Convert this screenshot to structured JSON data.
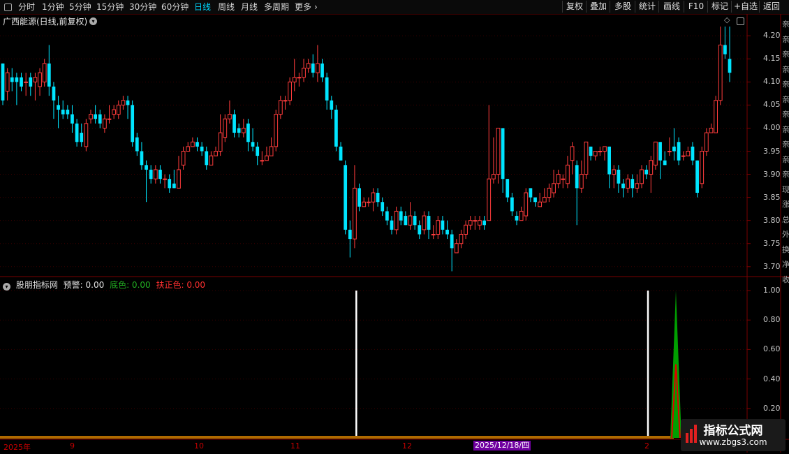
{
  "toolbar": {
    "timeframes": [
      "分时",
      "1分钟",
      "5分钟",
      "15分钟",
      "30分钟",
      "60分钟",
      "日线",
      "周线",
      "月线",
      "多周期",
      "更多"
    ],
    "active_timeframe": "日线",
    "right_buttons": [
      "复权",
      "叠加",
      "多股",
      "统计",
      "画线",
      "F10",
      "标记",
      "+自选",
      "返回"
    ]
  },
  "main_panel": {
    "title": "广西能源(日线,前复权)",
    "y_ticks": [
      "4.20",
      "4.15",
      "4.10",
      "4.05",
      "4.00",
      "3.95",
      "3.90",
      "3.85",
      "3.80",
      "3.75",
      "3.70"
    ]
  },
  "indicator_panel": {
    "name": "股朋指标网",
    "warning_label": "预警: 0.00",
    "bottom_label": "底色: 0.00",
    "support_label": "扶正色: 0.00",
    "y_ticks": [
      "1.00",
      "0.80",
      "0.60",
      "0.40",
      "0.20"
    ]
  },
  "date_axis": {
    "labels": [
      "2025年",
      "9",
      "10",
      "11",
      "12",
      "2"
    ],
    "highlight": "2025/12/18/四"
  },
  "right_panel_chars": [
    "亲",
    "亲",
    "亲",
    "亲",
    "亲",
    "亲",
    "亲",
    "亲",
    "亲",
    "亲",
    "亲",
    "现",
    "涨",
    "总",
    "外",
    "换",
    "净",
    "收"
  ],
  "watermark": {
    "title": "指标公式网",
    "url": "www.zbgs3.com"
  },
  "colors": {
    "up": "#ff3c3c",
    "down": "#00e5ff",
    "frame": "#7a0000",
    "indicator_green": "#00a000",
    "indicator_red": "#e00000",
    "baseline": "#b06a00"
  },
  "chart_data": {
    "type": "candlestick",
    "y_range": [
      3.68,
      4.22
    ],
    "candles": [
      [
        4.14,
        4.06,
        4.14,
        4.05
      ],
      [
        4.08,
        4.12,
        4.13,
        4.06
      ],
      [
        4.11,
        4.1,
        4.13,
        4.08
      ],
      [
        4.11,
        4.1,
        4.12,
        4.05
      ],
      [
        4.11,
        4.09,
        4.12,
        4.08
      ],
      [
        4.1,
        4.1,
        4.12,
        4.07
      ],
      [
        4.11,
        4.09,
        4.12,
        4.07
      ],
      [
        4.1,
        4.11,
        4.12,
        4.06
      ],
      [
        4.09,
        4.12,
        4.13,
        4.07
      ],
      [
        4.1,
        4.14,
        4.15,
        4.09
      ],
      [
        4.14,
        4.09,
        4.18,
        4.07
      ],
      [
        4.09,
        4.06,
        4.1,
        4.02
      ],
      [
        4.05,
        4.04,
        4.07,
        4.0
      ],
      [
        4.04,
        4.03,
        4.06,
        4.02
      ],
      [
        4.04,
        4.03,
        4.05,
        4.02
      ],
      [
        4.03,
        4.01,
        4.05,
        3.99
      ],
      [
        4.01,
        3.97,
        4.02,
        3.96
      ],
      [
        3.99,
        3.97,
        4.01,
        3.96
      ],
      [
        3.96,
        4.01,
        4.02,
        3.95
      ],
      [
        4.02,
        4.03,
        4.04,
        4.01
      ],
      [
        4.03,
        4.02,
        4.05,
        4.01
      ],
      [
        4.03,
        4.01,
        4.04,
        4.0
      ],
      [
        4.0,
        4.02,
        4.03,
        3.99
      ],
      [
        4.02,
        4.02,
        4.05,
        4.01
      ],
      [
        4.03,
        4.04,
        4.05,
        4.02
      ],
      [
        4.03,
        4.05,
        4.06,
        4.02
      ],
      [
        4.05,
        4.06,
        4.07,
        4.04
      ],
      [
        4.06,
        4.05,
        4.07,
        4.02
      ],
      [
        4.05,
        3.97,
        4.06,
        3.96
      ],
      [
        3.98,
        3.95,
        3.99,
        3.94
      ],
      [
        3.95,
        3.92,
        3.97,
        3.91
      ],
      [
        3.92,
        3.91,
        3.93,
        3.84
      ],
      [
        3.91,
        3.89,
        3.92,
        3.88
      ],
      [
        3.89,
        3.91,
        3.92,
        3.88
      ],
      [
        3.91,
        3.89,
        3.92,
        3.88
      ],
      [
        3.89,
        3.89,
        3.9,
        3.87
      ],
      [
        3.89,
        3.87,
        3.9,
        3.86
      ],
      [
        3.88,
        3.87,
        3.91,
        3.87
      ],
      [
        3.87,
        3.91,
        3.94,
        3.87
      ],
      [
        3.92,
        3.95,
        3.96,
        3.91
      ],
      [
        3.95,
        3.96,
        3.97,
        3.95
      ],
      [
        3.96,
        3.97,
        3.98,
        3.96
      ],
      [
        3.97,
        3.96,
        3.98,
        3.95
      ],
      [
        3.96,
        3.95,
        3.97,
        3.94
      ],
      [
        3.95,
        3.92,
        3.96,
        3.91
      ],
      [
        3.92,
        3.94,
        3.95,
        3.92
      ],
      [
        3.94,
        3.95,
        3.96,
        3.94
      ],
      [
        3.95,
        3.99,
        4.03,
        3.94
      ],
      [
        3.98,
        4.02,
        4.03,
        3.97
      ],
      [
        4.02,
        4.03,
        4.06,
        4.01
      ],
      [
        4.03,
        3.99,
        4.04,
        3.98
      ],
      [
        4.0,
        3.99,
        4.01,
        3.98
      ],
      [
        3.99,
        4.0,
        4.02,
        3.98
      ],
      [
        4.01,
        3.97,
        4.02,
        3.95
      ],
      [
        3.97,
        3.96,
        4.0,
        3.95
      ],
      [
        3.96,
        3.94,
        3.97,
        3.92
      ],
      [
        3.93,
        3.93,
        3.95,
        3.92
      ],
      [
        3.93,
        3.94,
        3.96,
        3.93
      ],
      [
        3.94,
        3.96,
        3.98,
        3.94
      ],
      [
        3.96,
        4.03,
        4.04,
        3.95
      ],
      [
        4.03,
        4.06,
        4.07,
        4.02
      ],
      [
        4.06,
        4.06,
        4.07,
        4.04
      ],
      [
        4.06,
        4.1,
        4.11,
        4.05
      ],
      [
        4.1,
        4.11,
        4.15,
        4.08
      ],
      [
        4.11,
        4.11,
        4.12,
        4.09
      ],
      [
        4.11,
        4.13,
        4.15,
        4.1
      ],
      [
        4.13,
        4.14,
        4.15,
        4.12
      ],
      [
        4.14,
        4.12,
        4.16,
        4.11
      ],
      [
        4.12,
        4.14,
        4.18,
        4.1
      ],
      [
        4.14,
        4.11,
        4.15,
        4.1
      ],
      [
        4.11,
        4.06,
        4.12,
        4.04
      ],
      [
        4.06,
        4.04,
        4.07,
        4.02
      ],
      [
        4.04,
        3.96,
        4.05,
        3.95
      ],
      [
        3.96,
        3.93,
        3.97,
        3.93
      ],
      [
        3.92,
        3.78,
        3.93,
        3.77
      ],
      [
        3.78,
        3.76,
        3.8,
        3.72
      ],
      [
        3.76,
        3.87,
        3.92,
        3.74
      ],
      [
        3.87,
        3.83,
        3.88,
        3.82
      ],
      [
        3.83,
        3.84,
        3.85,
        3.83
      ],
      [
        3.84,
        3.84,
        3.85,
        3.83
      ],
      [
        3.84,
        3.86,
        3.87,
        3.82
      ],
      [
        3.86,
        3.84,
        3.87,
        3.83
      ],
      [
        3.84,
        3.82,
        3.85,
        3.81
      ],
      [
        3.82,
        3.8,
        3.83,
        3.79
      ],
      [
        3.8,
        3.78,
        3.81,
        3.77
      ],
      [
        3.78,
        3.82,
        3.83,
        3.77
      ],
      [
        3.82,
        3.8,
        3.83,
        3.79
      ],
      [
        3.81,
        3.79,
        3.82,
        3.79
      ],
      [
        3.79,
        3.81,
        3.84,
        3.78
      ],
      [
        3.81,
        3.79,
        3.82,
        3.78
      ],
      [
        3.79,
        3.77,
        3.8,
        3.76
      ],
      [
        3.78,
        3.81,
        3.82,
        3.77
      ],
      [
        3.81,
        3.78,
        3.82,
        3.76
      ],
      [
        3.77,
        3.77,
        3.79,
        3.76
      ],
      [
        3.77,
        3.8,
        3.81,
        3.76
      ],
      [
        3.8,
        3.78,
        3.81,
        3.77
      ],
      [
        3.78,
        3.77,
        3.8,
        3.76
      ],
      [
        3.77,
        3.74,
        3.78,
        3.69
      ],
      [
        3.73,
        3.75,
        3.76,
        3.74
      ],
      [
        3.75,
        3.77,
        3.78,
        3.74
      ],
      [
        3.77,
        3.79,
        3.8,
        3.76
      ],
      [
        3.79,
        3.8,
        3.81,
        3.78
      ],
      [
        3.8,
        3.8,
        3.81,
        3.78
      ],
      [
        3.79,
        3.8,
        3.81,
        3.78
      ],
      [
        3.8,
        3.79,
        3.81,
        3.78
      ],
      [
        3.8,
        3.89,
        4.05,
        3.8
      ],
      [
        3.89,
        3.9,
        3.98,
        3.88
      ],
      [
        3.9,
        4.0,
        4.0,
        3.88
      ],
      [
        4.0,
        3.89,
        4.0,
        3.86
      ],
      [
        3.89,
        3.85,
        3.89,
        3.84
      ],
      [
        3.85,
        3.82,
        3.86,
        3.81
      ],
      [
        3.81,
        3.8,
        3.82,
        3.79
      ],
      [
        3.8,
        3.82,
        3.83,
        3.8
      ],
      [
        3.81,
        3.86,
        3.87,
        3.8
      ],
      [
        3.87,
        3.85,
        3.87,
        3.84
      ],
      [
        3.85,
        3.84,
        3.85,
        3.83
      ],
      [
        3.83,
        3.84,
        3.86,
        3.83
      ],
      [
        3.84,
        3.85,
        3.87,
        3.84
      ],
      [
        3.85,
        3.87,
        3.88,
        3.84
      ],
      [
        3.86,
        3.88,
        3.91,
        3.85
      ],
      [
        3.88,
        3.9,
        3.91,
        3.87
      ],
      [
        3.89,
        3.89,
        3.9,
        3.87
      ],
      [
        3.88,
        3.92,
        3.94,
        3.87
      ],
      [
        3.93,
        3.96,
        3.97,
        3.9
      ],
      [
        3.92,
        3.87,
        3.93,
        3.79
      ],
      [
        3.87,
        3.9,
        3.93,
        3.86
      ],
      [
        3.9,
        3.97,
        3.97,
        3.89
      ],
      [
        3.96,
        3.94,
        3.96,
        3.93
      ],
      [
        3.94,
        3.95,
        3.95,
        3.93
      ],
      [
        3.95,
        3.95,
        3.96,
        3.94
      ],
      [
        3.95,
        3.96,
        3.96,
        3.93
      ],
      [
        3.96,
        3.9,
        3.96,
        3.87
      ],
      [
        3.9,
        3.91,
        3.92,
        3.87
      ],
      [
        3.91,
        3.88,
        3.92,
        3.86
      ],
      [
        3.88,
        3.87,
        3.89,
        3.85
      ],
      [
        3.87,
        3.89,
        3.9,
        3.86
      ],
      [
        3.89,
        3.87,
        3.9,
        3.85
      ],
      [
        3.87,
        3.88,
        3.9,
        3.86
      ],
      [
        3.88,
        3.91,
        3.92,
        3.87
      ],
      [
        3.91,
        3.9,
        3.92,
        3.89
      ],
      [
        3.9,
        3.93,
        3.94,
        3.86
      ],
      [
        3.92,
        3.97,
        3.97,
        3.91
      ],
      [
        3.97,
        3.93,
        3.97,
        3.89
      ],
      [
        3.93,
        3.92,
        3.95,
        3.92
      ],
      [
        3.95,
        3.95,
        3.98,
        3.94
      ],
      [
        3.96,
        3.95,
        4.0,
        3.93
      ],
      [
        3.97,
        3.93,
        3.98,
        3.92
      ],
      [
        3.94,
        3.94,
        3.95,
        3.93
      ],
      [
        3.94,
        3.95,
        3.96,
        3.94
      ],
      [
        3.96,
        3.93,
        3.97,
        3.92
      ],
      [
        3.93,
        3.86,
        3.93,
        3.85
      ],
      [
        3.88,
        3.95,
        3.96,
        3.87
      ],
      [
        3.95,
        3.99,
        4.0,
        3.94
      ],
      [
        3.99,
        4.0,
        4.01,
        3.99
      ],
      [
        3.99,
        4.06,
        4.07,
        3.99
      ],
      [
        4.06,
        4.18,
        4.22,
        4.05
      ],
      [
        4.18,
        4.16,
        4.22,
        4.15
      ],
      [
        4.15,
        4.12,
        4.22,
        4.1
      ]
    ],
    "indicator": {
      "y_range": [
        0,
        1
      ],
      "signal_bars_index": [
        75,
        138
      ],
      "spike_green": 1.0,
      "spike_red": 0.5
    }
  }
}
